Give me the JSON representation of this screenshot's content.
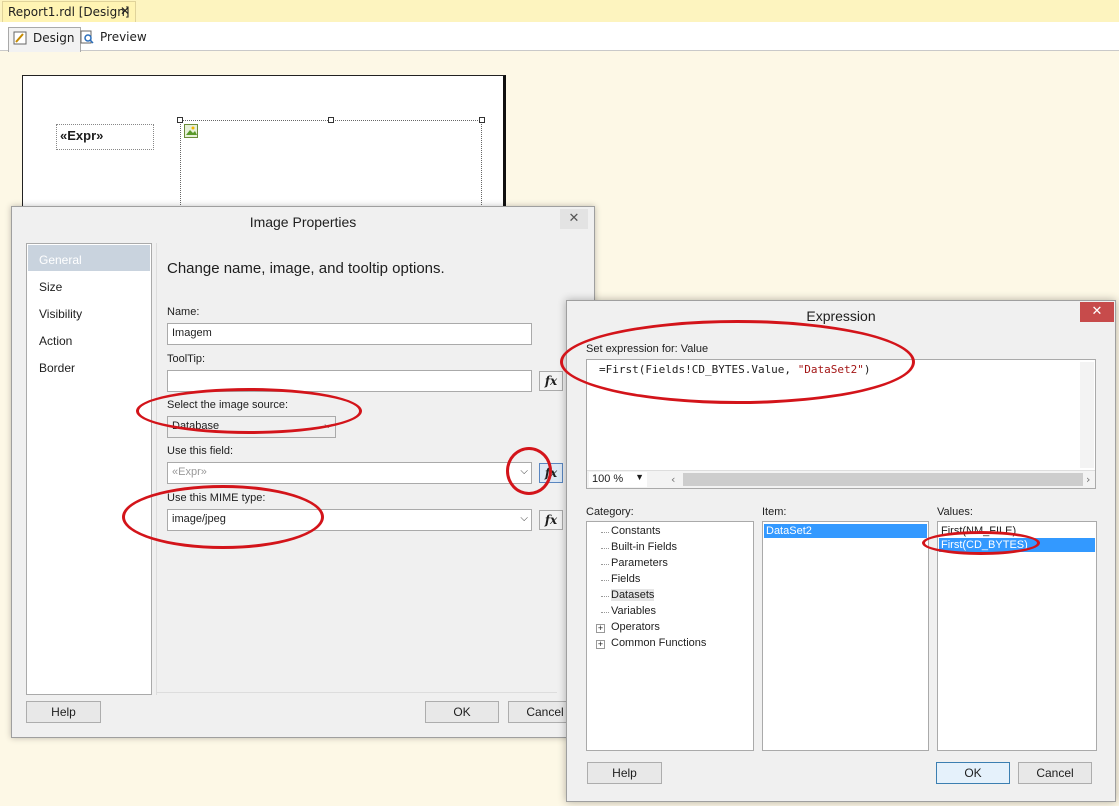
{
  "doc_tab": {
    "title": "Report1.rdl [Design]",
    "close": "✕"
  },
  "view_tabs": {
    "design": "Design",
    "preview": "Preview"
  },
  "report": {
    "textbox_expr": "«Expr»"
  },
  "image_properties": {
    "title": "Image Properties",
    "close": "✕",
    "nav": [
      "General",
      "Size",
      "Visibility",
      "Action",
      "Border"
    ],
    "selected_nav": "General",
    "description": "Change name, image, and tooltip options.",
    "name_label": "Name:",
    "name_value": "Imagem",
    "tooltip_label": "ToolTip:",
    "tooltip_value": "",
    "source_label": "Select the image source:",
    "source_value": "Database",
    "field_label": "Use this field:",
    "field_value": "«Expr»",
    "mime_label": "Use this MIME type:",
    "mime_value": "image/jpeg",
    "fx": "fx",
    "help": "Help",
    "ok": "OK",
    "cancel": "Cancel"
  },
  "expression": {
    "title": "Expression",
    "close": "✕",
    "set_label": "Set expression for: Value",
    "expr_prefix": "=First(Fields!CD_BYTES.Value, ",
    "expr_string": "\"DataSet2\"",
    "expr_suffix": ")",
    "zoom": "100 %",
    "category_label": "Category:",
    "categories": [
      "Constants",
      "Built-in Fields",
      "Parameters",
      "Fields",
      "Datasets",
      "Variables",
      "Operators",
      "Common Functions"
    ],
    "item_label": "Item:",
    "items": [
      "DataSet2"
    ],
    "values_label": "Values:",
    "values": [
      "First(NM_FILE)",
      "First(CD_BYTES)"
    ],
    "help": "Help",
    "ok": "OK",
    "cancel": "Cancel"
  },
  "colors": {
    "annotation": "#d3141a",
    "selection": "#3399ff",
    "close_red": "#c74b4b"
  }
}
